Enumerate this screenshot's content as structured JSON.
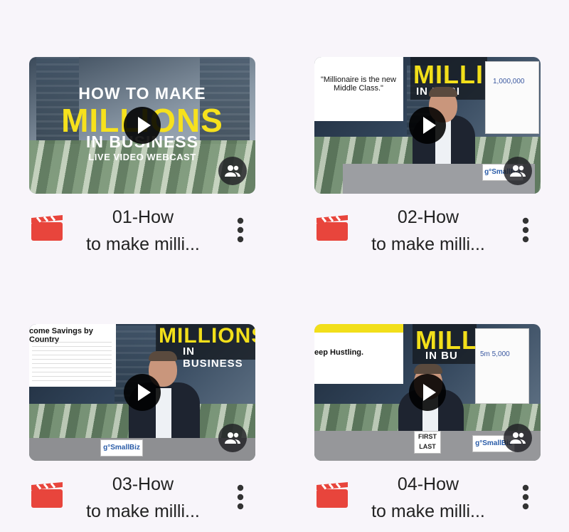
{
  "files": [
    {
      "title_line1": "01-How",
      "title_line2": "to make milli..."
    },
    {
      "title_line1": "02-How",
      "title_line2": "to make milli..."
    },
    {
      "title_line1": "03-How",
      "title_line2": "to make milli..."
    },
    {
      "title_line1": "04-How",
      "title_line2": "to make milli..."
    }
  ],
  "thumb1": {
    "line1": "HOW TO MAKE",
    "line2": "MILLIONS",
    "line3": "IN BUSINESS",
    "line4": "LIVE VIDEO WEBCAST"
  },
  "thumb2": {
    "quote": "\"Millionaire is the new Middle Class.\"",
    "big": "MILLI",
    "small": "IN BUSI",
    "board": "1,000,000",
    "logo": "g°SmallBiz"
  },
  "thumb3": {
    "slide_title": "come Savings by Country",
    "big": "MILLIONS",
    "small": "IN BUSINESS",
    "logo": "g°SmallBiz"
  },
  "thumb4": {
    "slide_text": "eep Hustling.",
    "big": "MILL",
    "small": "IN BU",
    "board_text": "5m  5,000",
    "logo": "g°SmallBiz",
    "book": "FIRST LAST"
  },
  "colors": {
    "file_icon": "#e8453c",
    "highlight": "#f6e11d",
    "background": "#f8f5fa"
  },
  "icons": {
    "file": "video-clapperboard-icon",
    "shared": "people-icon",
    "play": "play-icon",
    "more": "more-vert-icon"
  }
}
